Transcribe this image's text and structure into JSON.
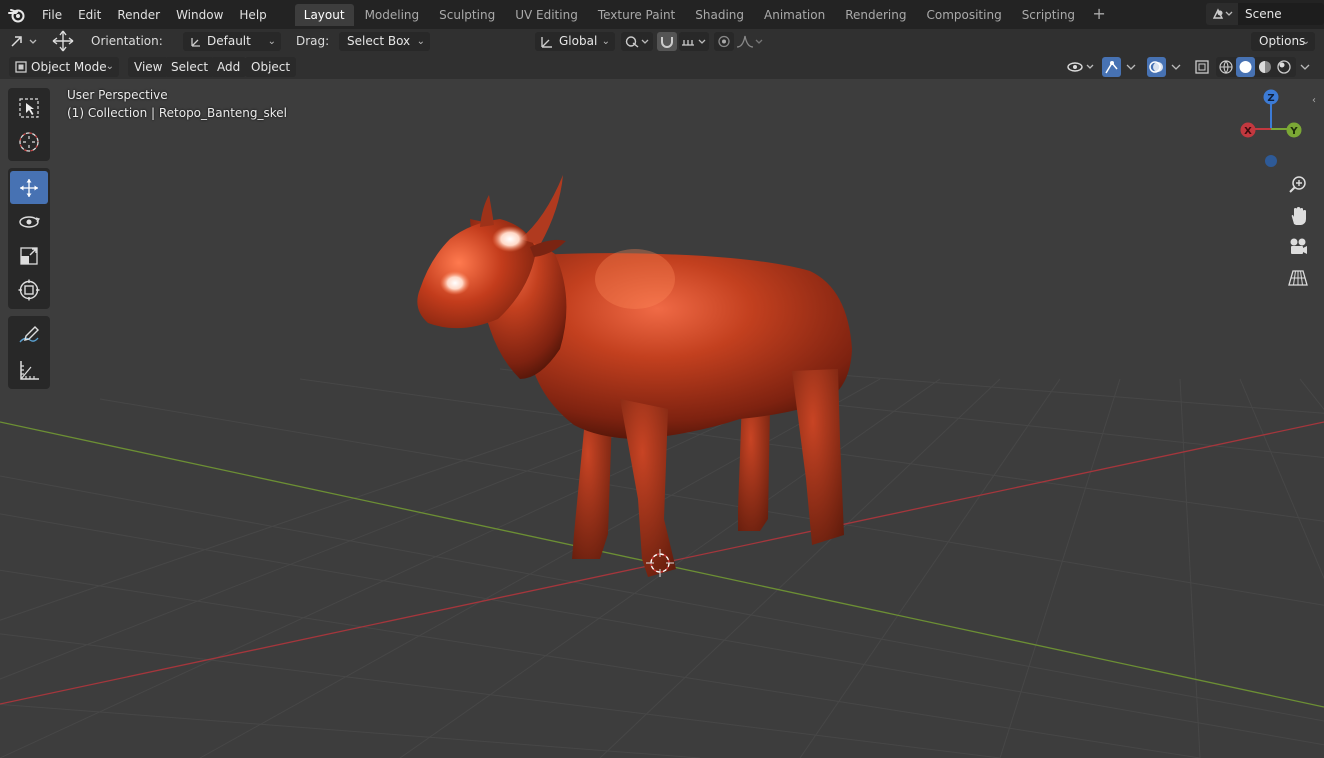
{
  "topbar": {
    "menus": [
      "File",
      "Edit",
      "Render",
      "Window",
      "Help"
    ],
    "workspace_tabs": [
      "Layout",
      "Modeling",
      "Sculpting",
      "UV Editing",
      "Texture Paint",
      "Shading",
      "Animation",
      "Rendering",
      "Compositing",
      "Scripting"
    ],
    "active_tab": "Layout",
    "add_tab_label": "+",
    "scene_name": "Scene"
  },
  "toolsettings": {
    "orientation_label": "Orientation:",
    "orientation_value": "Default",
    "drag_label": "Drag:",
    "drag_value": "Select Box",
    "transform_orientation": "Global",
    "options_label": "Options"
  },
  "header": {
    "mode": "Object Mode",
    "view": "View",
    "select": "Select",
    "add": "Add",
    "object": "Object"
  },
  "viewport": {
    "perspective_label": "User Perspective",
    "collection_label": "(1) Collection | Retopo_Banteng_skel",
    "axis_x": "X",
    "axis_y": "Y",
    "axis_z": "Z"
  },
  "colors": {
    "model": "#b2341e",
    "accent": "#4772b3",
    "x_axis": "#c3383f",
    "y_axis": "#7ba835",
    "z_axis": "#3c7bd6",
    "grid": "#4a4a4a",
    "background": "#3d3d3d"
  },
  "icons": [
    "blender-logo-icon",
    "select-box-tool-icon",
    "cursor-tool-icon",
    "move-tool-icon",
    "rotate-tool-icon",
    "scale-tool-icon",
    "transform-tool-icon",
    "annotate-tool-icon",
    "measure-tool-icon",
    "zoom-icon",
    "pan-hand-icon",
    "camera-icon",
    "ortho-grid-icon"
  ]
}
